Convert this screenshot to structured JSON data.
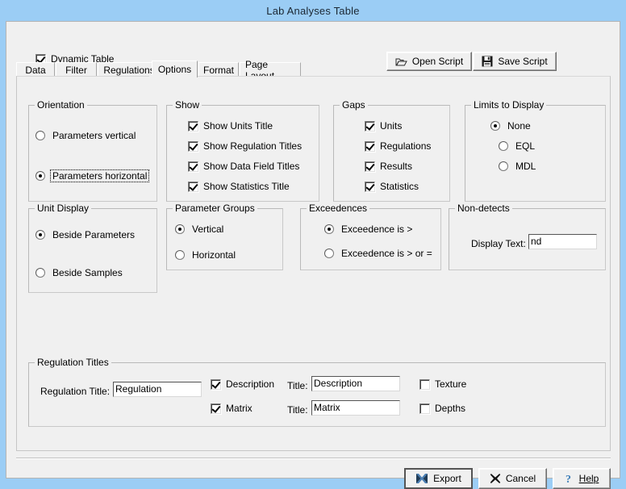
{
  "window": {
    "title": "Lab Analyses Table",
    "titlebar_color": "#9bcdf5",
    "client_color": "#f0f0f0"
  },
  "toolbar": {
    "dynamic_table": {
      "label": "Dynamic Table",
      "checked": true
    },
    "open_script": {
      "label": "Open Script",
      "icon": "open-folder-icon"
    },
    "save_script": {
      "label": "Save Script",
      "icon": "floppy-disk-icon"
    }
  },
  "tabs": [
    {
      "label": "Data",
      "active": false
    },
    {
      "label": "Filter",
      "active": false
    },
    {
      "label": "Regulations",
      "active": false
    },
    {
      "label": "Options",
      "active": true
    },
    {
      "label": "Format",
      "active": false
    },
    {
      "label": "Page Layout",
      "active": false
    }
  ],
  "groups": {
    "orientation": {
      "title": "Orientation",
      "options": [
        {
          "label": "Parameters vertical",
          "selected": false,
          "focused": false
        },
        {
          "label": "Parameters horizontal",
          "selected": true,
          "focused": true
        }
      ]
    },
    "show": {
      "title": "Show",
      "options": [
        {
          "label": "Show Units Title",
          "checked": true
        },
        {
          "label": "Show Regulation Titles",
          "checked": true
        },
        {
          "label": "Show Data Field Titles",
          "checked": true
        },
        {
          "label": "Show Statistics Title",
          "checked": true
        }
      ]
    },
    "gaps": {
      "title": "Gaps",
      "options": [
        {
          "label": "Units",
          "checked": true
        },
        {
          "label": "Regulations",
          "checked": true
        },
        {
          "label": "Results",
          "checked": true
        },
        {
          "label": "Statistics",
          "checked": true
        }
      ]
    },
    "limits_to_display": {
      "title": "Limits to Display",
      "options": [
        {
          "label": "None",
          "selected": true
        },
        {
          "label": "EQL",
          "selected": false
        },
        {
          "label": "MDL",
          "selected": false
        }
      ]
    },
    "unit_display": {
      "title": "Unit Display",
      "options": [
        {
          "label": "Beside Parameters",
          "selected": true
        },
        {
          "label": "Beside Samples",
          "selected": false
        }
      ]
    },
    "parameter_groups": {
      "title": "Parameter Groups",
      "options": [
        {
          "label": "Vertical",
          "selected": true
        },
        {
          "label": "Horizontal",
          "selected": false
        }
      ]
    },
    "exceedences": {
      "title": "Exceedences",
      "options": [
        {
          "label": "Exceedence is >",
          "selected": true
        },
        {
          "label": "Exceedence is > or =",
          "selected": false
        }
      ]
    },
    "non_detects": {
      "title": "Non-detects",
      "display_text_label": "Display Text:",
      "display_text_value": "nd"
    },
    "regulation_titles": {
      "title": "Regulation Titles",
      "regulation_title_label": "Regulation Title:",
      "regulation_title_value": "Regulation",
      "rows": [
        {
          "checkbox_label": "Description",
          "checked": true,
          "title_label": "Title:",
          "title_value": "Description",
          "extra_checkbox_label": "Texture",
          "extra_checked": false
        },
        {
          "checkbox_label": "Matrix",
          "checked": true,
          "title_label": "Title:",
          "title_value": "Matrix",
          "extra_checkbox_label": "Depths",
          "extra_checked": false
        }
      ]
    }
  },
  "footer": {
    "export": {
      "label": "Export",
      "icon": "excel-x-icon"
    },
    "cancel": {
      "label": "Cancel",
      "icon": "x-mark-icon"
    },
    "help": {
      "label": "Help",
      "icon": "question-mark-icon"
    }
  }
}
